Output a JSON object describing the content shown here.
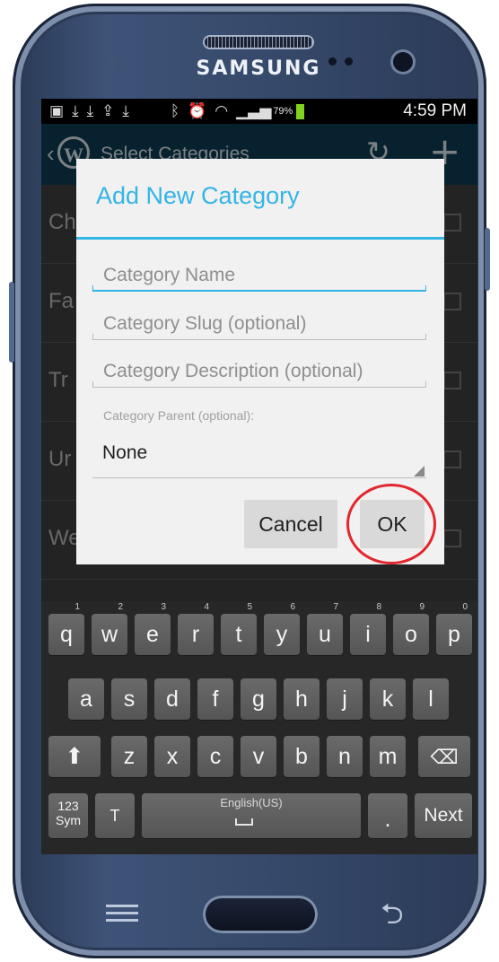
{
  "device": {
    "brand": "SAMSUNG",
    "menu_icon": "menu-lines",
    "back_icon": "back-arrow"
  },
  "status_bar": {
    "battery_percent": "79%",
    "time": "4:59 PM",
    "battery_color": "#7ed321",
    "left_icons": [
      "chat-icon",
      "download-icon",
      "download-icon",
      "upload-icon",
      "download-icon"
    ],
    "right_icons": [
      "bluetooth-icon",
      "alarm-icon",
      "wifi-icon",
      "signal-icon"
    ]
  },
  "action_bar": {
    "title": "Select Categories",
    "color": "#0e3f54",
    "icons": [
      "back-chevron",
      "wordpress-logo",
      "refresh-icon",
      "add-icon"
    ]
  },
  "category_list": {
    "items": [
      "Ch",
      "Fa",
      "Tr",
      "Ur",
      "We"
    ]
  },
  "dialog": {
    "title": "Add New Category",
    "accent_color": "#33b5e5",
    "name_placeholder": "Category Name",
    "slug_placeholder": "Category Slug (optional)",
    "description_placeholder": "Category Description (optional)",
    "parent_label": "Category Parent (optional):",
    "parent_value": "None",
    "cancel_label": "Cancel",
    "ok_label": "OK",
    "highlight_color": "#e3262e"
  },
  "keyboard": {
    "row1": [
      {
        "key": "q",
        "num": "1"
      },
      {
        "key": "w",
        "num": "2"
      },
      {
        "key": "e",
        "num": "3"
      },
      {
        "key": "r",
        "num": "4"
      },
      {
        "key": "t",
        "num": "5"
      },
      {
        "key": "y",
        "num": "6"
      },
      {
        "key": "u",
        "num": "7"
      },
      {
        "key": "i",
        "num": "8"
      },
      {
        "key": "o",
        "num": "9"
      },
      {
        "key": "p",
        "num": "0"
      }
    ],
    "row2": [
      "a",
      "s",
      "d",
      "f",
      "g",
      "h",
      "j",
      "k",
      "l"
    ],
    "row3": [
      "z",
      "x",
      "c",
      "v",
      "b",
      "n",
      "m"
    ],
    "shift_icon": "shift-arrow",
    "backspace_icon": "backspace-icon",
    "sym_top": "123",
    "sym_bottom": "Sym",
    "tools_label": "T",
    "space_label": "English(US)",
    "period_label": ".",
    "next_label": "Next"
  }
}
